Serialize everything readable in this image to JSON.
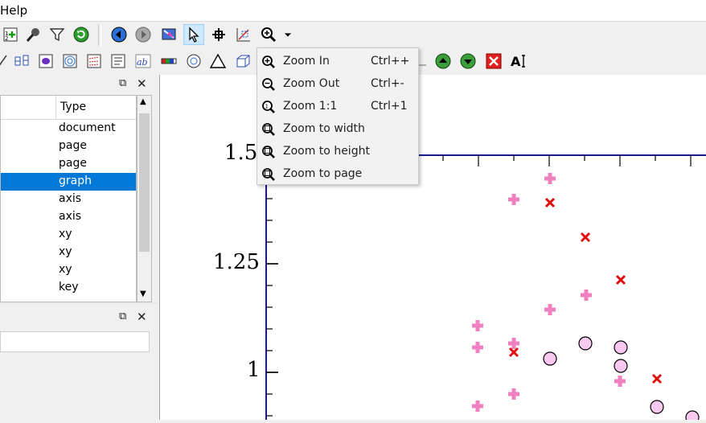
{
  "menubar": {
    "help_label": "Help"
  },
  "tree": {
    "type_header": "Type",
    "rows": [
      "document",
      "page",
      "page",
      "graph",
      "axis",
      "axis",
      "xy",
      "xy",
      "xy",
      "key"
    ],
    "selected_index": 3
  },
  "zoom_menu": {
    "items": [
      {
        "label": "Zoom In",
        "shortcut": "Ctrl++",
        "icon": "zoom-in-icon"
      },
      {
        "label": "Zoom Out",
        "shortcut": "Ctrl+-",
        "icon": "zoom-out-icon"
      },
      {
        "label": "Zoom 1:1",
        "shortcut": "Ctrl+1",
        "icon": "zoom-1to1-icon"
      },
      {
        "label": "Zoom to width",
        "shortcut": "",
        "icon": "zoom-width-icon"
      },
      {
        "label": "Zoom to height",
        "shortcut": "",
        "icon": "zoom-height-icon"
      },
      {
        "label": "Zoom to page",
        "shortcut": "",
        "icon": "zoom-page-icon"
      }
    ]
  },
  "plot": {
    "y_ticks": [
      "1.5",
      "1.25",
      "1"
    ],
    "colors": {
      "plus": "#f080c0",
      "cross": "#e01010",
      "circle_fill": "#f8c8f0",
      "axis": "#1a1a8c"
    }
  }
}
